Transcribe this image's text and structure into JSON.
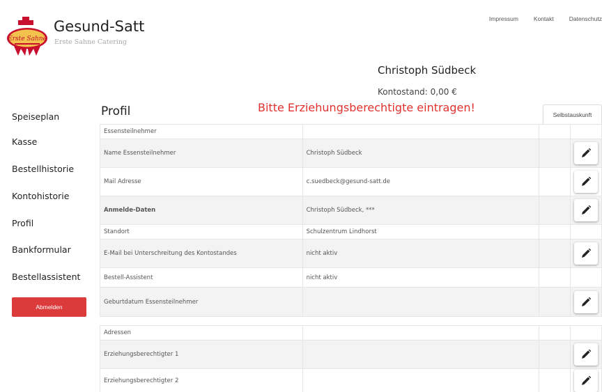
{
  "topnav": {
    "impressum": "Impressum",
    "kontakt": "Kontakt",
    "datenschutz": "Datenschutz"
  },
  "brand": {
    "name": "Gesund-Satt",
    "tagline": "Erste Sahne Catering",
    "logo_text": "Erste Sahne"
  },
  "user": {
    "name": "Christoph Südbeck",
    "balance": "Kontostand: 0,00 €"
  },
  "warning": "Bitte Erziehungsberechtigte eintragen!",
  "selbstauskunft_label": "Selbstauskunft",
  "page_title": "Profil",
  "sidebar": {
    "items": [
      {
        "label": "Speiseplan"
      },
      {
        "label": "Kasse"
      },
      {
        "label": "Bestellhistorie"
      },
      {
        "label": "Kontohistorie"
      },
      {
        "label": "Profil"
      },
      {
        "label": "Bankformular"
      },
      {
        "label": "Bestellassistent"
      }
    ],
    "logout_label": "Abmelden"
  },
  "profile_section": {
    "header": "Essensteilnehmer",
    "rows": [
      {
        "label": "Name Essensteilnehmer",
        "value": "Christoph Südbeck",
        "editable": true
      },
      {
        "label": "Mail Adresse",
        "value": "c.suedbeck@gesund-satt.de",
        "editable": true
      },
      {
        "label": "Anmelde-Daten",
        "value": "Christoph Südbeck, ***",
        "editable": true
      },
      {
        "label": "Standort",
        "value": "Schulzentrum Lindhorst",
        "editable": false
      },
      {
        "label": "E-Mail bei Unterschreitung des Kontostandes",
        "value": "nicht aktiv",
        "editable": true
      },
      {
        "label": "Bestell-Assistent",
        "value": "nicht aktiv",
        "editable": false
      },
      {
        "label": "Geburtdatum Essensteilnehmer",
        "value": "",
        "editable": true
      }
    ]
  },
  "address_section": {
    "header": "Adressen",
    "rows": [
      {
        "label": "Erziehungsberechtigter 1",
        "editable": true
      },
      {
        "label": "Erziehungsberechtigter 2",
        "editable": true
      }
    ]
  },
  "colors": {
    "accent_red": "#e0312e",
    "logout_button": "#dc3b3b",
    "logo_red": "#c8102e",
    "logo_gold": "#f2c14e"
  },
  "icons": {
    "edit": "pencil-icon"
  }
}
